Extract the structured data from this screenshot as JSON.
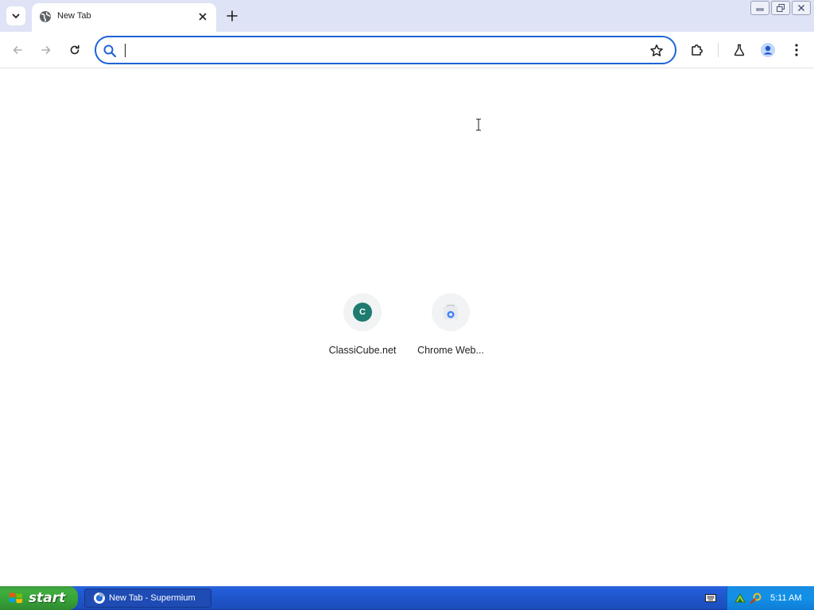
{
  "window": {
    "tab_search_icon": "chevron-down-icon",
    "controls": [
      "minimize",
      "restore",
      "close"
    ]
  },
  "tab": {
    "title": "New Tab",
    "favicon": "globe-icon",
    "close_icon": "close-icon"
  },
  "new_tab_icon": "plus-icon",
  "toolbar": {
    "back_icon": "back-arrow-icon",
    "forward_icon": "forward-arrow-icon",
    "reload_icon": "reload-icon",
    "omnibox": {
      "value": "",
      "placeholder": "",
      "search_icon": "search-icon",
      "bookmark_icon": "star-icon"
    },
    "extensions_icon": "puzzle-icon",
    "labs_icon": "flask-icon",
    "profile_icon": "profile-icon",
    "menu_icon": "kebab-menu-icon"
  },
  "shortcuts": [
    {
      "label": "ClassiCube.net",
      "letter": "C",
      "icon_color": "#1e7b6f"
    },
    {
      "label": "Chrome Web...",
      "icon": "chrome-web-store-icon"
    }
  ],
  "taskbar": {
    "start_label": "start",
    "task_label": "New Tab - Supermium",
    "clock": "5:11 AM"
  },
  "colors": {
    "accent": "#1f63d6",
    "tabstrip": "#dee3f5",
    "taskbar": "#245edb",
    "start_green": "#3fae3f"
  }
}
